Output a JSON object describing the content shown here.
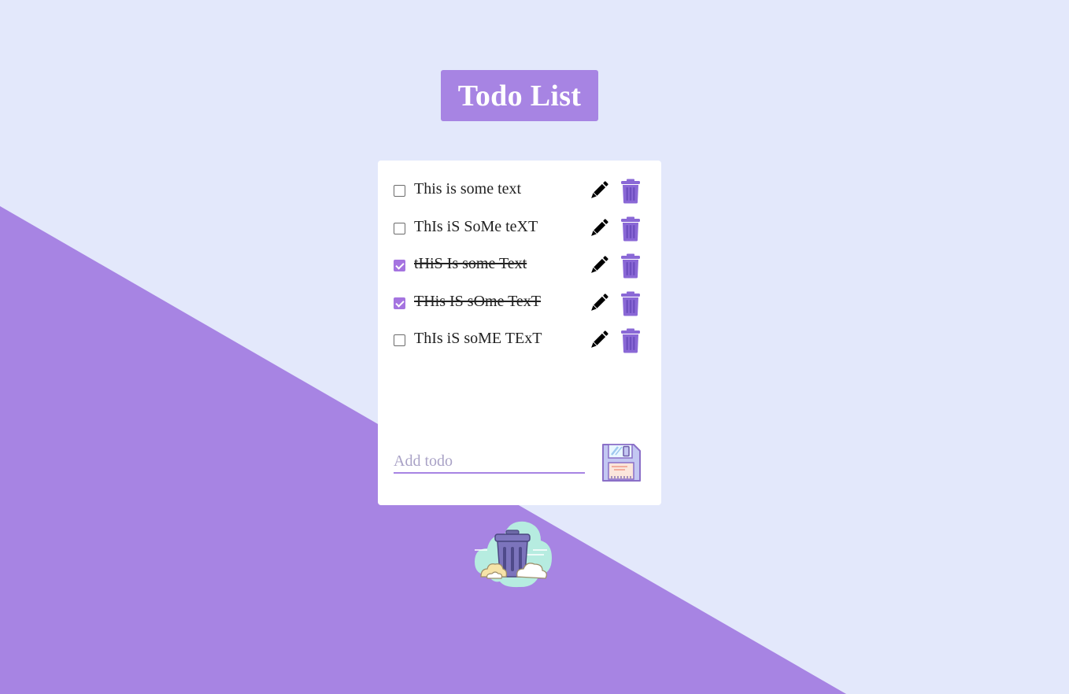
{
  "header": {
    "title": "Todo List"
  },
  "todos": [
    {
      "text": "This is some text",
      "done": false
    },
    {
      "text": "ThIs iS SoMe teXT",
      "done": false
    },
    {
      "text": "tHiS Is some Text",
      "done": true
    },
    {
      "text": "THis IS sOme TexT",
      "done": true
    },
    {
      "text": "ThIs iS soME TExT",
      "done": false
    }
  ],
  "add": {
    "placeholder": "Add todo",
    "value": ""
  },
  "icons": {
    "edit": "pencil-icon",
    "delete": "trash-can-icon",
    "save": "floppy-disk-icon",
    "clear_all": "trash-bin-cloud-icon"
  },
  "colors": {
    "background_light": "#e3e8fb",
    "accent_purple": "#a784e3",
    "trash_purple": "#8a68d6",
    "card": "#ffffff"
  }
}
